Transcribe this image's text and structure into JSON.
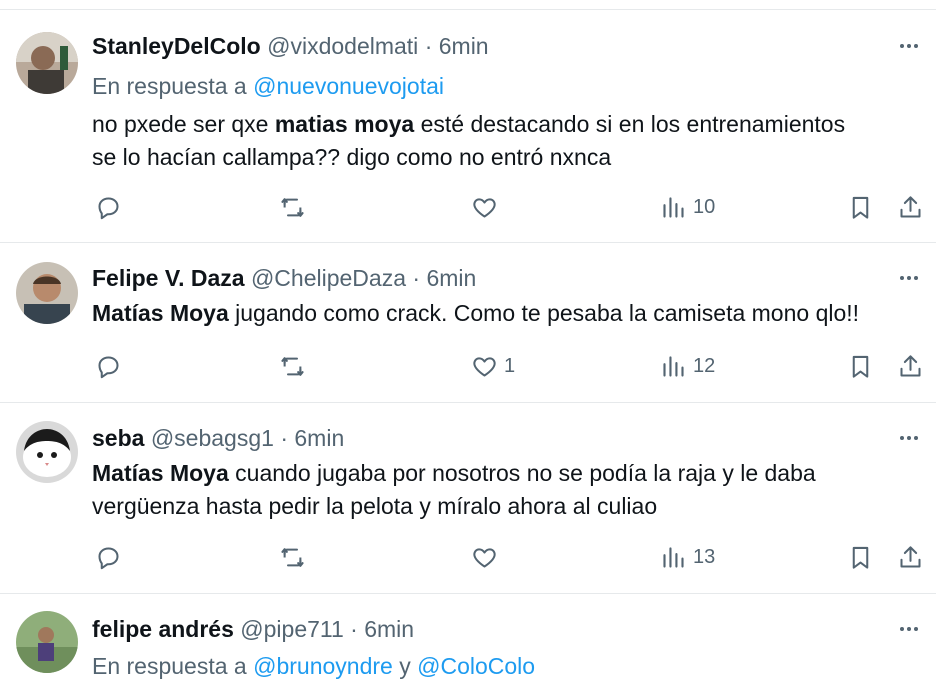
{
  "tweets": [
    {
      "name": "StanleyDelColo",
      "handle": "@vixdodelmati",
      "sep": "·",
      "time": "6min",
      "reply_prefix": "En respuesta a",
      "reply_mention": "@nuevonuevojotai",
      "text_line1_pre": "no pxede ser qxe ",
      "text_line1_bold": "matias moya",
      "text_line1_post": " esté destacando si en los entrenamientos",
      "text_line2": "se lo hacían callampa?? digo como no entró nxnca",
      "likes": "",
      "views": "10"
    },
    {
      "name": "Felipe V. Daza",
      "handle": "@ChelipeDaza",
      "sep": "·",
      "time": "6min",
      "text_bold": "Matías Moya",
      "text_rest": " jugando como crack. Como te pesaba la camiseta mono qlo!!",
      "likes": "1",
      "views": "12"
    },
    {
      "name": "seba",
      "handle": "@sebagsg1",
      "sep": "·",
      "time": "6min",
      "text_bold": "Matías Moya",
      "text_line1_rest": " cuando jugaba por nosotros no se podía la raja y le daba",
      "text_line2": "vergüenza hasta pedir la pelota y míralo ahora al culiao",
      "likes": "",
      "views": "13"
    },
    {
      "name": "felipe andrés",
      "handle": "@pipe711",
      "sep": "·",
      "time": "6min",
      "reply_prefix": "En respuesta a",
      "reply_mention1": "@brunoyndre",
      "reply_and": "y",
      "reply_mention2": "@ColoColo"
    }
  ],
  "icons": {
    "reply": "reply-icon",
    "retweet": "retweet-icon",
    "like": "heart-icon",
    "views": "views-icon",
    "bookmark": "bookmark-icon",
    "share": "share-icon",
    "more": "more-icon"
  },
  "colors": {
    "text": "#0f1419",
    "secondary": "#536471",
    "link": "#1d9bf0",
    "divider": "#e6e9eb"
  }
}
